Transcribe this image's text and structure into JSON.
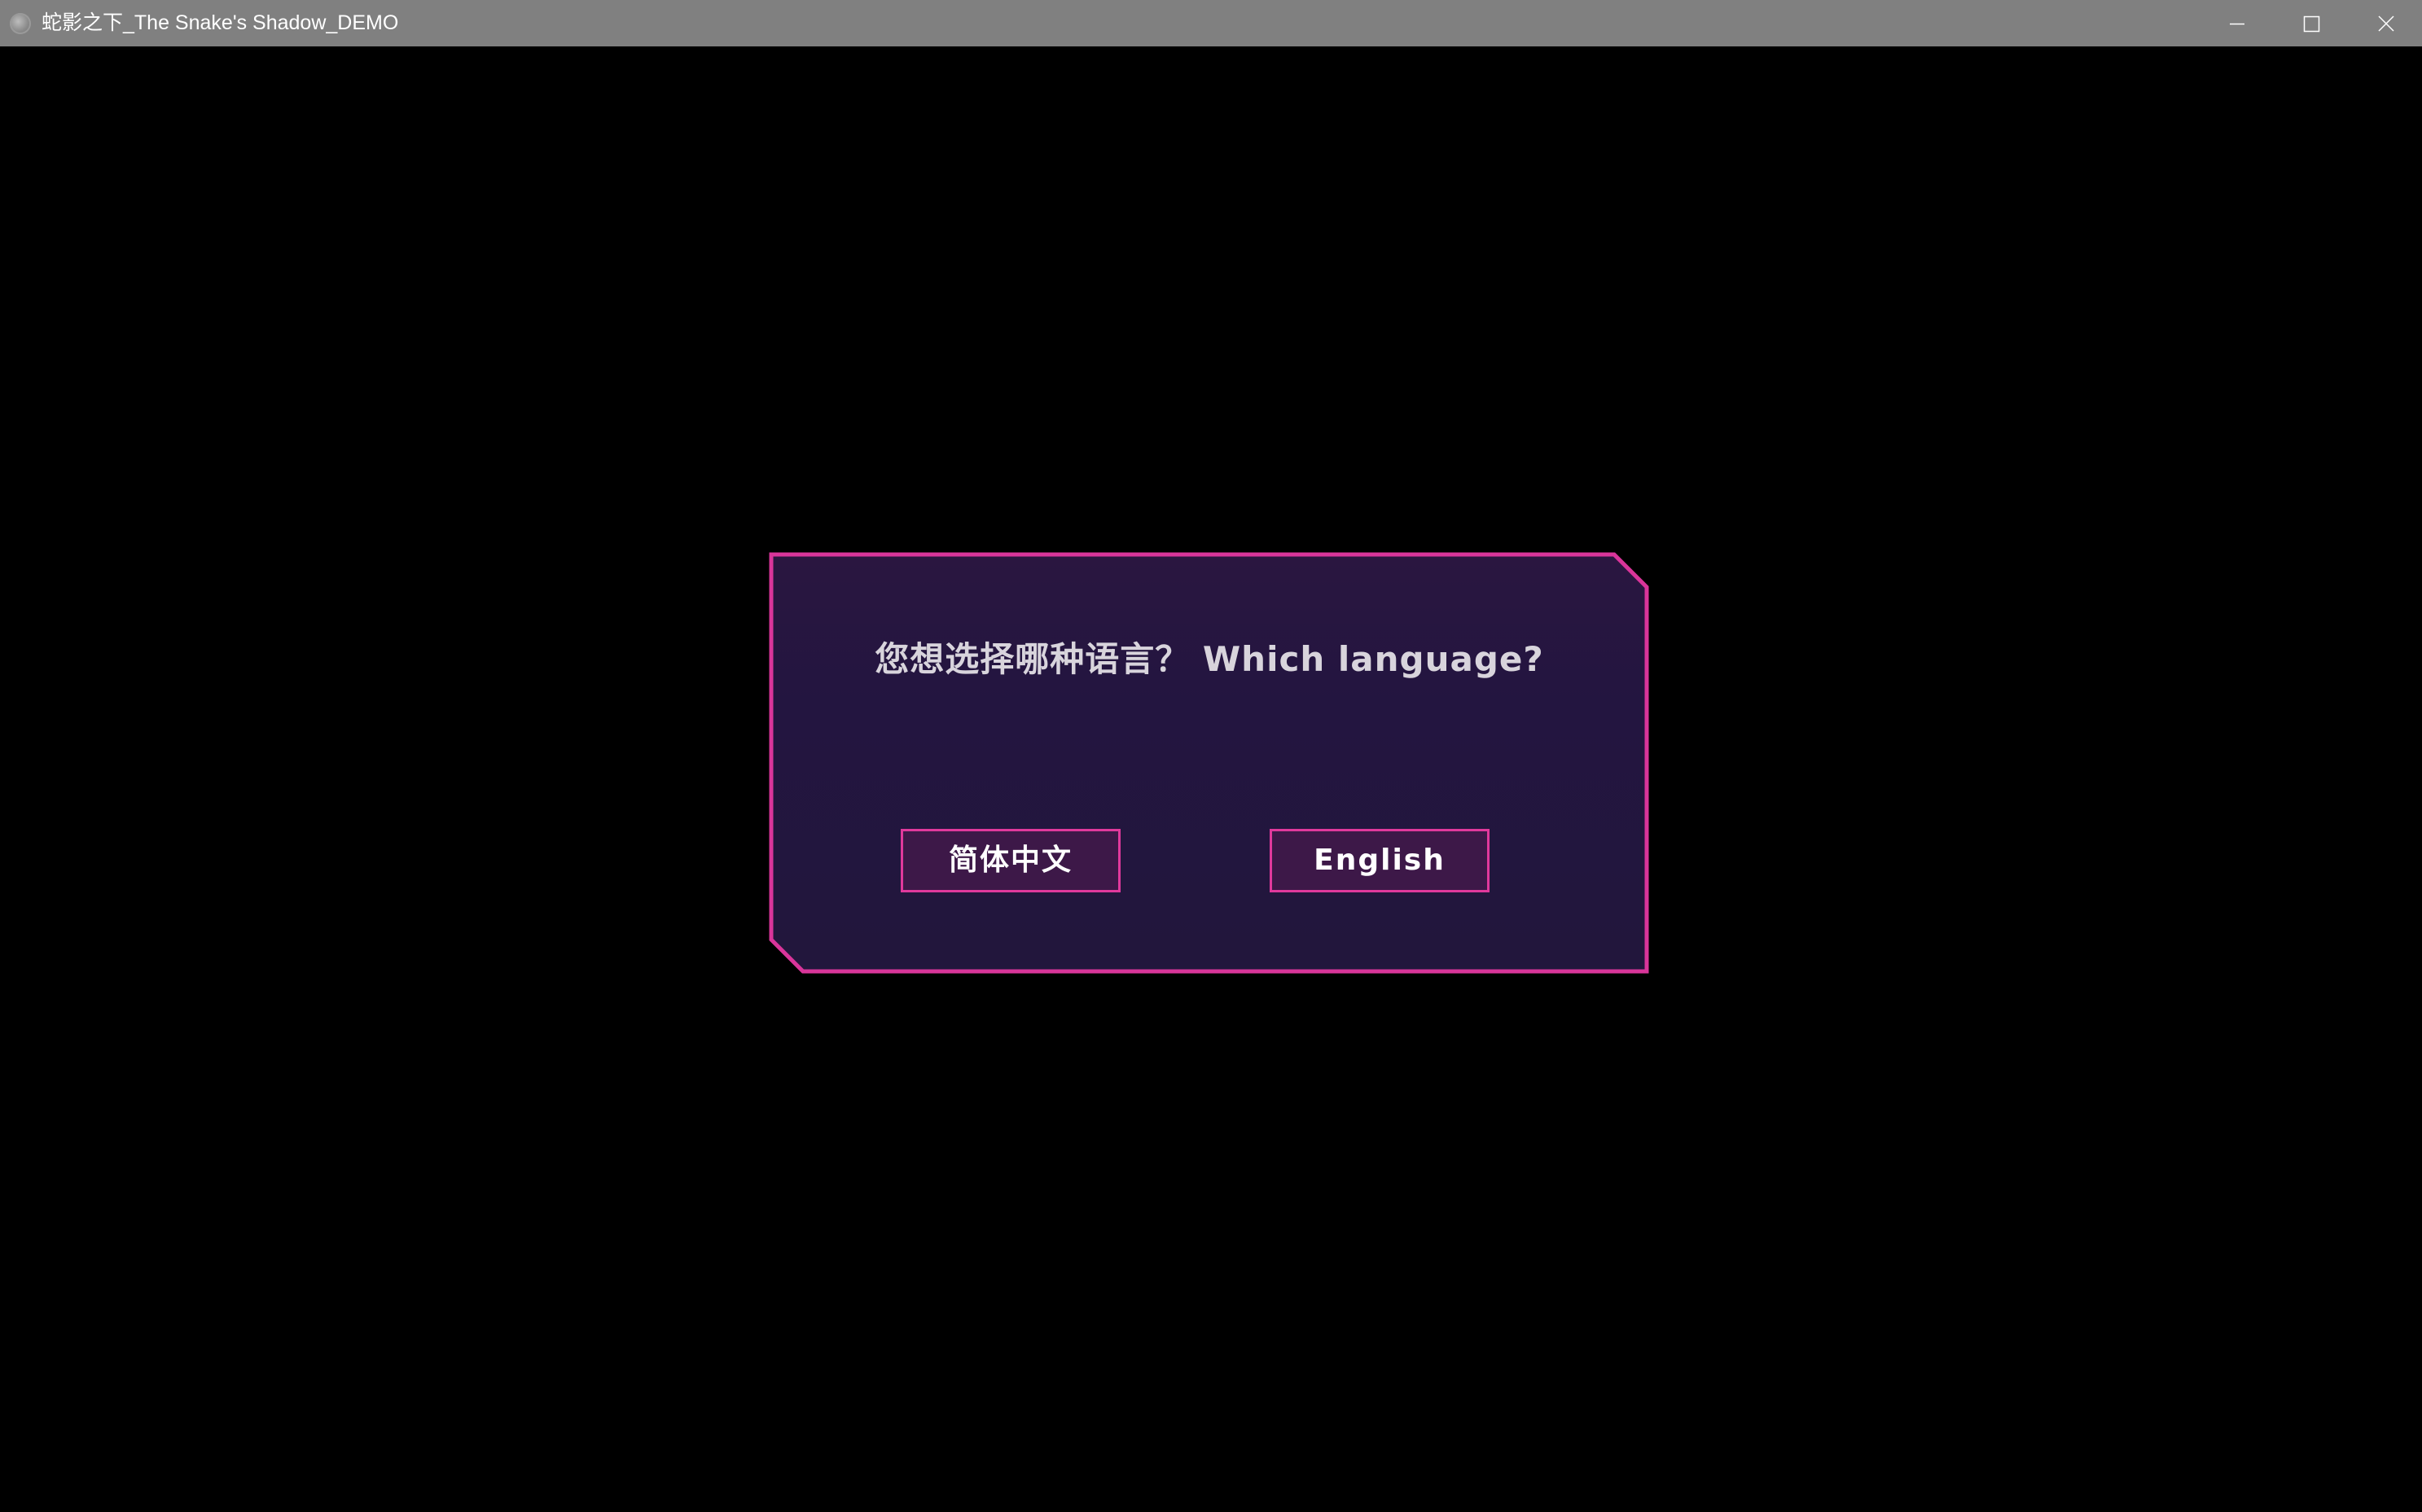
{
  "window": {
    "title": "蛇影之下_The Snake's Shadow_DEMO",
    "controls": {
      "minimize_icon": "minimize-icon",
      "maximize_icon": "maximize-icon",
      "close_icon": "close-icon"
    }
  },
  "dialog": {
    "question": "您想选择哪种语言？ Which language?",
    "options": [
      {
        "label": "简体中文"
      },
      {
        "label": "English"
      }
    ]
  },
  "colors": {
    "background": "#000000",
    "titlebar": "#808080",
    "dialog_fill": "#231540",
    "accent_border": "#e0399c",
    "button_fill": "#3d1848",
    "title_text": "#d8d4dc"
  }
}
